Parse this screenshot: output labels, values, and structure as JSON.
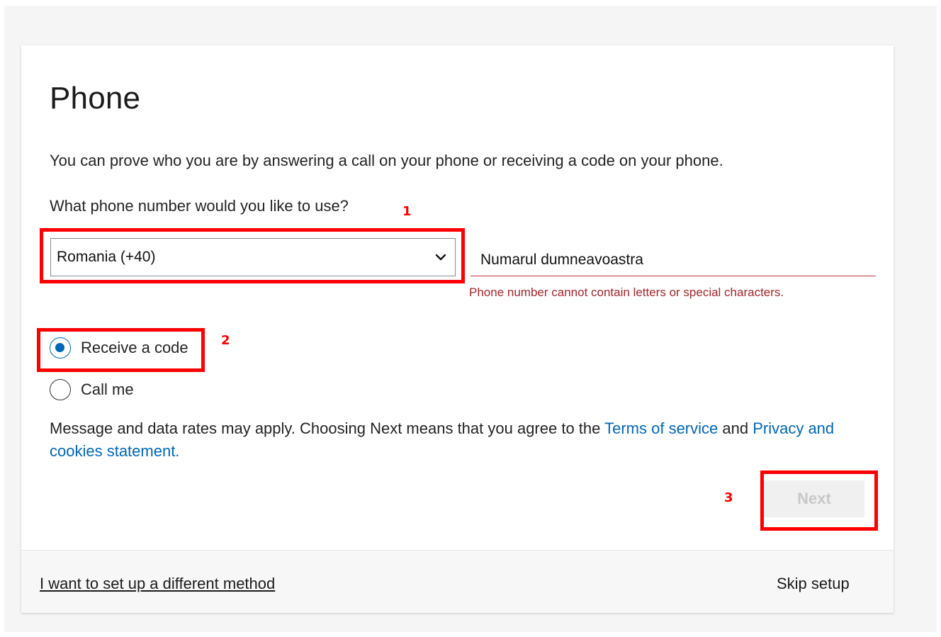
{
  "card": {
    "title": "Phone",
    "description": "You can prove who you are by answering a call on your phone or receiving a code on your phone.",
    "question": "What phone number would you like to use?",
    "country_select": {
      "value": "Romania (+40)"
    },
    "phone_input": {
      "value": "Numarul dumneavoastra"
    },
    "error_message": "Phone number cannot contain letters or special characters.",
    "options": [
      {
        "label": "Receive a code",
        "selected": true
      },
      {
        "label": "Call me",
        "selected": false
      }
    ],
    "consent": {
      "text_before": "Message and data rates may apply. Choosing Next means that you agree to the ",
      "terms_link": "Terms of service",
      "text_middle": " and ",
      "privacy_link": "Privacy and cookies statement."
    },
    "next_button": {
      "label": "Next",
      "disabled": true
    }
  },
  "footer": {
    "different_method_link": "I want to set up a different method",
    "skip_link": "Skip setup"
  },
  "annotations": {
    "labels": [
      "1",
      "2",
      "3"
    ],
    "color": "#ff0000"
  },
  "colors": {
    "accent": "#0067b8",
    "error": "#a4262c",
    "annotation": "#ff0000"
  }
}
